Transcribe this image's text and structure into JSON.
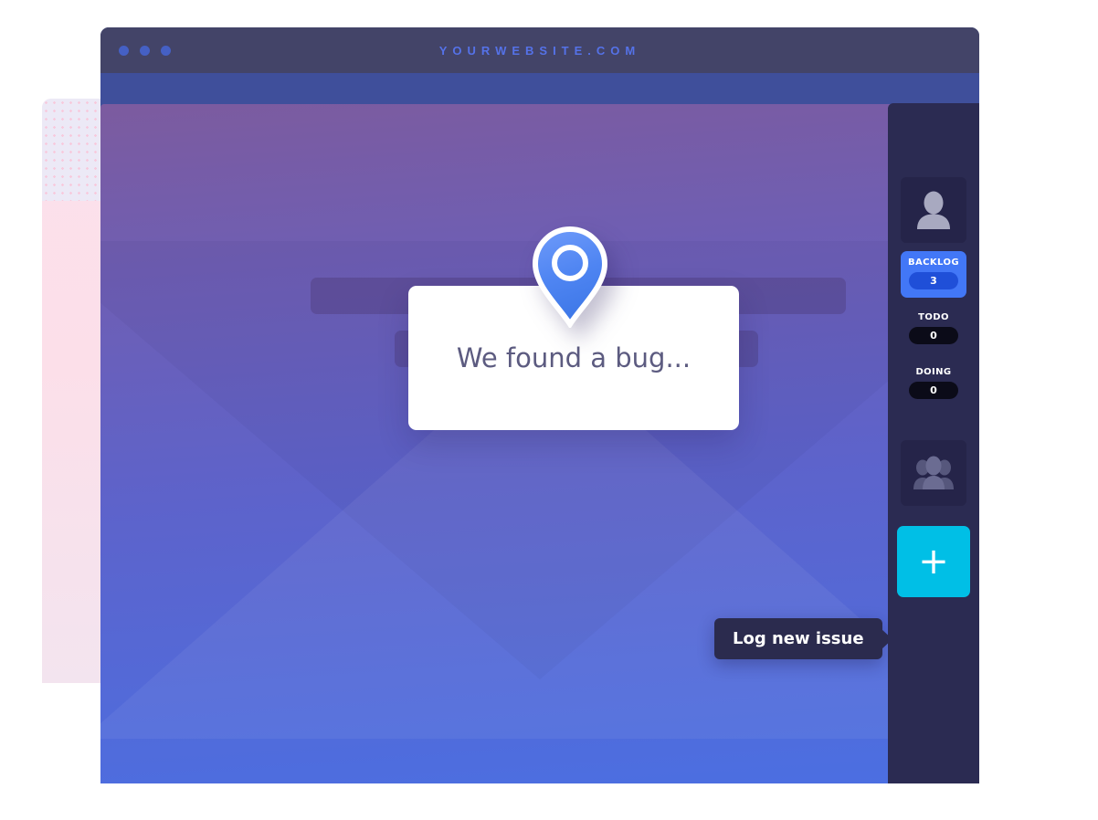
{
  "browser": {
    "title": "YOURWEBSITE.COM",
    "traffic_lights": [
      "window-dot-1",
      "window-dot-2",
      "window-dot-3"
    ],
    "dot_color": "#4560c4",
    "title_color": "#5572e8",
    "title_bar_color": "#434468",
    "toolbar_color": "#3f4f9b"
  },
  "page": {
    "background_gradient_from": "#7c5b9f",
    "background_gradient_to": "#4b6fe2",
    "placeholder_bars": [
      "wide",
      "narrow"
    ]
  },
  "card": {
    "text": "We found a bug...",
    "text_color": "#5c5b80",
    "background": "#ffffff"
  },
  "pin": {
    "icon": "map-pin-icon",
    "fill_from": "#5a8bf5",
    "fill_to": "#3f7bea",
    "outline": "#ffffff"
  },
  "tooltip": {
    "text": "Log new issue",
    "background": "#2b2b4e",
    "text_color": "#ffffff"
  },
  "sidebar": {
    "background": "#2b2b52",
    "avatar_icon": "person-icon",
    "team_icon": "people-group-icon",
    "statuses": [
      {
        "label": "BACKLOG",
        "count": "3",
        "active": true
      },
      {
        "label": "TODO",
        "count": "0",
        "active": false
      },
      {
        "label": "DOING",
        "count": "0",
        "active": false
      }
    ],
    "active_color": "#4277f7",
    "add_button": {
      "icon": "plus-icon",
      "label": "+",
      "color": "#00bfe6"
    }
  }
}
